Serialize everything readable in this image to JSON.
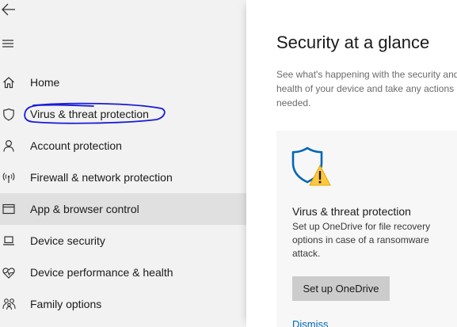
{
  "sidebar": {
    "back_icon": "back-arrow-icon",
    "menu_icon": "hamburger-menu-icon",
    "items": [
      {
        "label": "Home",
        "icon": "home-icon",
        "selected": false
      },
      {
        "label": "Virus & threat protection",
        "icon": "shield-icon",
        "selected": false
      },
      {
        "label": "Account protection",
        "icon": "person-icon",
        "selected": false
      },
      {
        "label": "Firewall & network protection",
        "icon": "wifi-antenna-icon",
        "selected": false
      },
      {
        "label": "App & browser control",
        "icon": "browser-window-icon",
        "selected": true
      },
      {
        "label": "Device security",
        "icon": "laptop-icon",
        "selected": false
      },
      {
        "label": "Device performance & health",
        "icon": "heart-pulse-icon",
        "selected": false
      },
      {
        "label": "Family options",
        "icon": "family-icon",
        "selected": false
      }
    ],
    "annotation_color": "#1a1ad6"
  },
  "main": {
    "title": "Security at a glance",
    "subtitle": "See what's happening with the security and health of your device and take any actions needed.",
    "card": {
      "icon": "shield-warning-icon",
      "title": "Virus & threat protection",
      "description": "Set up OneDrive for file recovery options in case of a ransomware attack.",
      "button_label": "Set up OneDrive",
      "link_label": "Dismiss"
    }
  },
  "colors": {
    "sidebar_bg": "#f2f2f2",
    "selected_bg": "#e0e0e0",
    "accent": "#0067b8",
    "warning": "#ffc83d"
  }
}
